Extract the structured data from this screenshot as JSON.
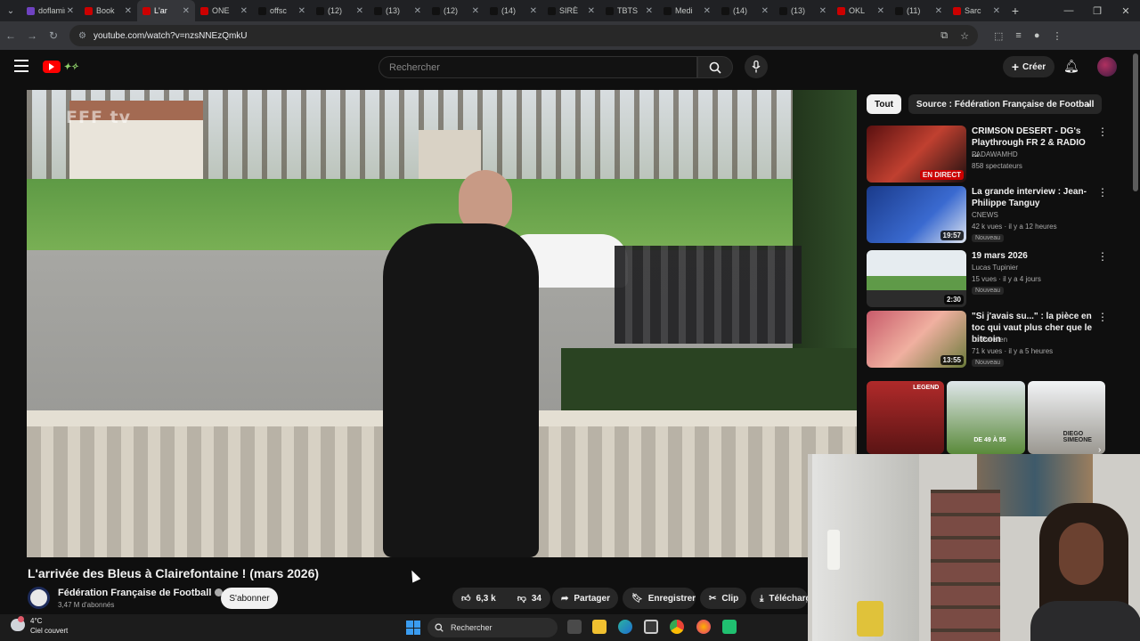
{
  "browser": {
    "tabs": [
      {
        "title": "doflamingo",
        "color": "#6f42c1",
        "icon": "generic-tab-icon"
      },
      {
        "title": "Book",
        "color": "#cc0000",
        "icon": "youtube-tab-icon"
      },
      {
        "title": "L'ar",
        "color": "#cc0000",
        "icon": "youtube-tab-icon",
        "active": true
      },
      {
        "title": "ONE",
        "color": "#cc0000",
        "icon": "youtube-tab-icon"
      },
      {
        "title": "offsc",
        "color": "#111111",
        "icon": "tiktok-tab-icon"
      },
      {
        "title": "(12)",
        "color": "#111111",
        "icon": "x-tab-icon"
      },
      {
        "title": "(13)",
        "color": "#111111",
        "icon": "x-tab-icon"
      },
      {
        "title": "(12)",
        "color": "#111111",
        "icon": "x-tab-icon"
      },
      {
        "title": "(14)",
        "color": "#111111",
        "icon": "x-tab-icon"
      },
      {
        "title": "SIRÈ",
        "color": "#111111",
        "icon": "x-tab-icon"
      },
      {
        "title": "TBTS",
        "color": "#111111",
        "icon": "x-tab-icon"
      },
      {
        "title": "Medi",
        "color": "#111111",
        "icon": "x-tab-icon"
      },
      {
        "title": "(14)",
        "color": "#111111",
        "icon": "x-tab-icon"
      },
      {
        "title": "(13)",
        "color": "#111111",
        "icon": "x-tab-icon"
      },
      {
        "title": "OKL",
        "color": "#cc0000",
        "icon": "youtube-tab-icon"
      },
      {
        "title": "(11)",
        "color": "#111111",
        "icon": "x-tab-icon"
      },
      {
        "title": "Sarc",
        "color": "#cc0000",
        "icon": "youtube-tab-icon"
      }
    ],
    "url": "youtube.com/watch?v=nzsNNEzQmkU"
  },
  "header": {
    "search_placeholder": "Rechercher",
    "create_label": "Créer"
  },
  "player": {
    "watermark": "FFF tv"
  },
  "video": {
    "title": "L'arrivée des Bleus à Clairefontaine ! (mars 2026)",
    "channel": "Fédération Française de Football",
    "subscribers": "3,47 M d'abonnés",
    "subscribe_label": "S'abonner",
    "likes": "6,3 k",
    "dislikes": "34",
    "share_label": "Partager",
    "save_label": "Enregistrer",
    "clip_label": "Clip",
    "download_label": "Télécharger"
  },
  "sidebar": {
    "chips": [
      "Tout",
      "Source : Fédération Française de Football"
    ],
    "recommendations": [
      {
        "title": "CRIMSON DESERT - DG's Playthrough FR 2 & RADIO ...",
        "channel": "PADAWAMHD",
        "meta": "858 spectateurs",
        "badge": "",
        "overlay": "EN DIRECT",
        "live": true
      },
      {
        "title": "La grande interview : Jean-Philippe Tanguy",
        "channel": "CNEWS",
        "meta": "42 k vues · il y a 12 heures",
        "badge": "Nouveau",
        "overlay": "19:57",
        "live": false
      },
      {
        "title": "19 mars 2026",
        "channel": "Lucas Tupinier",
        "meta": "15 vues · il y a 4 jours",
        "badge": "Nouveau",
        "overlay": "2:30",
        "live": false
      },
      {
        "title": "\"Si j'avais su...\" : la pièce en toc qui vaut plus cher que le bitcoin",
        "channel": "Le Parisien",
        "meta": "71 k vues · il y a 5 heures",
        "badge": "Nouveau",
        "overlay": "13:55",
        "live": false
      }
    ],
    "shorts": [
      {
        "label": "LEGEND"
      },
      {
        "label": "DE 49 À 55"
      },
      {
        "label": "DIEGO SIMEONE"
      }
    ]
  },
  "taskbar": {
    "temperature": "4°C",
    "condition": "Ciel couvert",
    "search_label": "Rechercher"
  }
}
